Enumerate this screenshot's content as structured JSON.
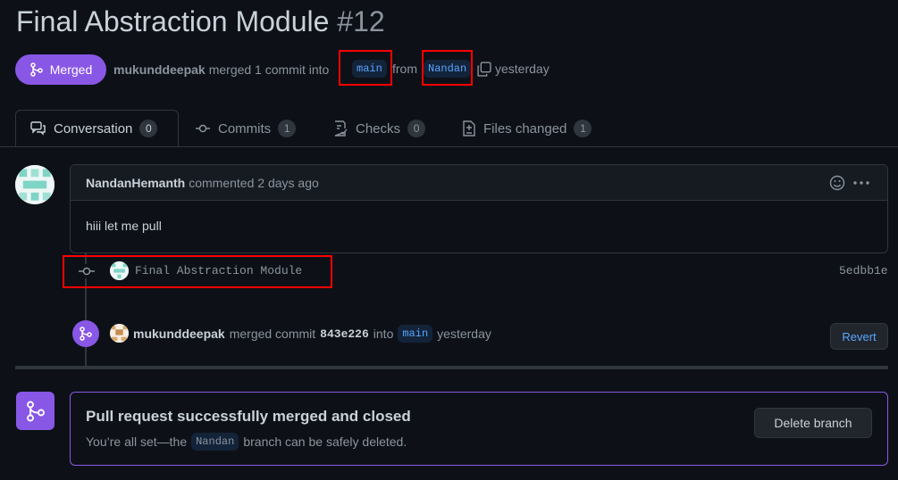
{
  "header": {
    "title": "Final Abstraction Module",
    "number": "#12"
  },
  "meta": {
    "state_label": "Merged",
    "author": "mukunddeepak",
    "text_merged": "merged 1 commit into",
    "base_branch": "main",
    "text_from": "from",
    "head_branch": "Nandan",
    "time": "yesterday"
  },
  "tabs": [
    {
      "label": "Conversation",
      "count": "0"
    },
    {
      "label": "Commits",
      "count": "1"
    },
    {
      "label": "Checks",
      "count": "0"
    },
    {
      "label": "Files changed",
      "count": "1"
    }
  ],
  "comment": {
    "author": "NandanHemanth",
    "action": "commented 2 days ago",
    "body": "hiii let me pull"
  },
  "commit": {
    "message": "Final Abstraction Module",
    "sha": "5edbb1e"
  },
  "merge_event": {
    "user": "mukunddeepak",
    "text_merged_commit": "merged commit",
    "sha": "843e226",
    "text_into": "into",
    "branch": "main",
    "time": "yesterday",
    "revert_label": "Revert"
  },
  "merged_box": {
    "title": "Pull request successfully merged and closed",
    "desc_before": "You’re all set—the",
    "branch": "Nandan",
    "desc_after": "branch can be safely deleted.",
    "delete_label": "Delete branch"
  },
  "colors": {
    "merged": "#8957e5",
    "accent_blue": "#58a6ff",
    "annotation_red": "#ff0000"
  }
}
